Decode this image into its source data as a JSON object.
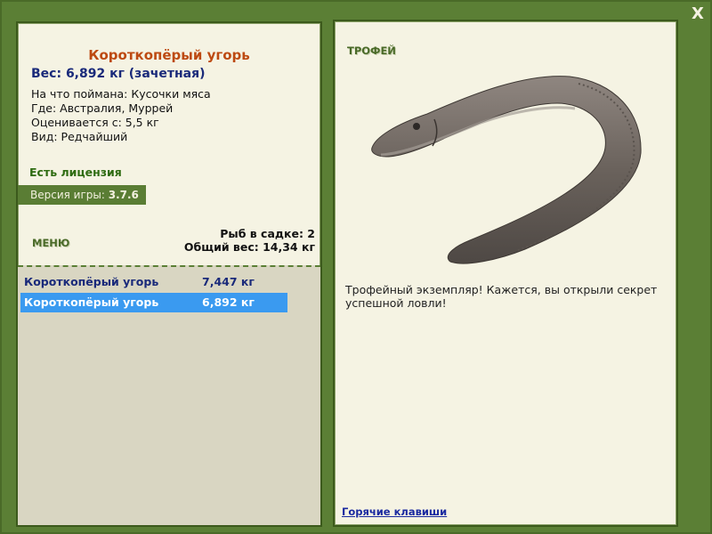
{
  "window": {
    "close_label": "X"
  },
  "fish": {
    "title": "Короткопёрый угорь",
    "weight_line": "Вес: 6,892 кг (зачетная)",
    "bait_line": "На что поймана: Кусочки мяса",
    "location_line": "Где: Австралия, Муррей",
    "valued_line": "Оценивается с: 5,5 кг",
    "rarity_line": "Вид: Редчайший"
  },
  "license": {
    "label": "Есть лицензия"
  },
  "version": {
    "label": "Версия игры:",
    "value": "3.7.6"
  },
  "menu": {
    "label": "МЕНЮ"
  },
  "cage": {
    "count_line": "Рыб в садке: 2",
    "total_line": "Общий вес: 14,34 кг"
  },
  "catches": [
    {
      "name": "Короткопёрый угорь",
      "weight": "7,447 кг",
      "selected": false
    },
    {
      "name": "Короткопёрый угорь",
      "weight": "6,892 кг",
      "selected": true
    }
  ],
  "trophy": {
    "label": "ТРОФЕЙ",
    "text": "Трофейный экземпляр! Кажется, вы открыли секрет успешной ловли!"
  },
  "footer": {
    "hotkeys_label": "Горячие клавиши"
  },
  "colors": {
    "frame": "#5b7f35",
    "panel": "#f5f3e3",
    "title": "#bd4a12",
    "weight": "#1a2a7a",
    "license": "#2e6b11",
    "selection": "#3a9af0"
  }
}
